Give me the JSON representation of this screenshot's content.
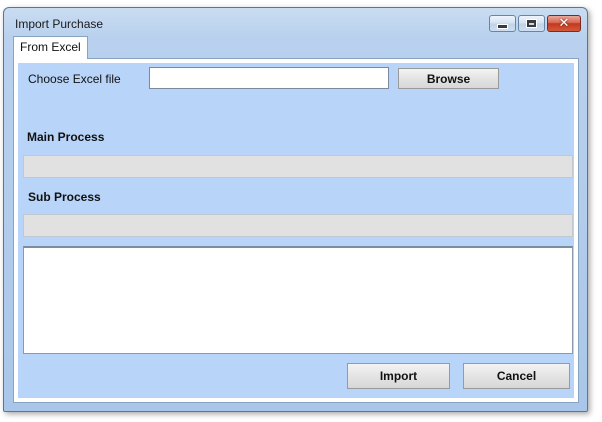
{
  "window": {
    "title": "Import Purchase",
    "controls": {
      "minimize": "minimize-icon",
      "maximize": "maximize-icon",
      "close": "close-icon",
      "close_glyph": "✕"
    }
  },
  "tabs": [
    {
      "label": "From Excel",
      "active": true
    }
  ],
  "form": {
    "file_label": "Choose Excel file",
    "file_value": "",
    "file_placeholder": "",
    "browse_label": "Browse",
    "main_process_label": "Main Process",
    "main_process_progress": 0,
    "sub_process_label": "Sub Process",
    "sub_process_progress": 0,
    "log_text": ""
  },
  "actions": {
    "import_label": "Import",
    "cancel_label": "Cancel"
  },
  "colors": {
    "panel_background": "#b8d4f9",
    "progress_track": "#e1e1e1",
    "close_button": "#c2391f"
  }
}
